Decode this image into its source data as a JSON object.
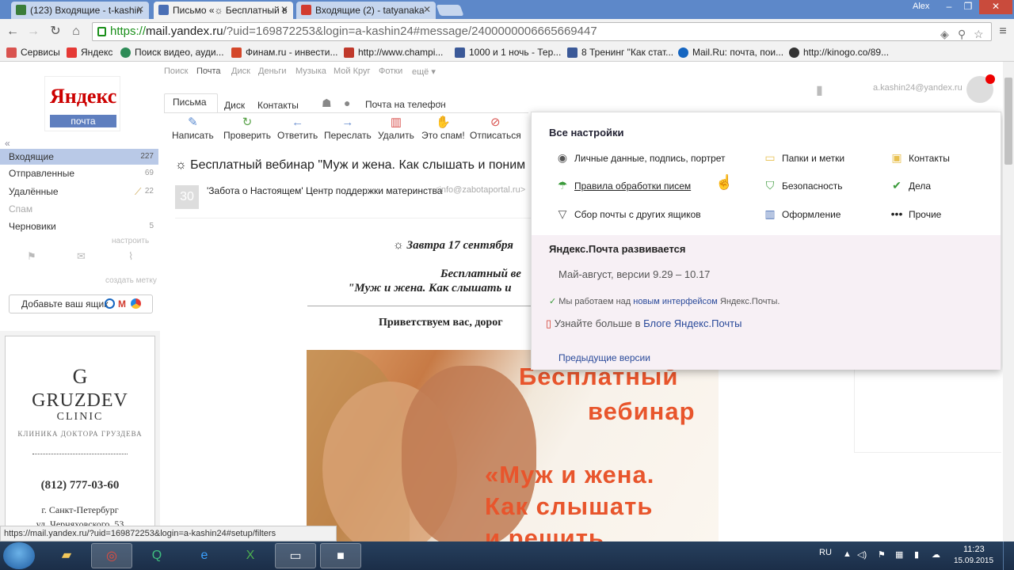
{
  "browser": {
    "tabs": [
      {
        "label": "(123) Входящие - t-kashin",
        "active": false,
        "favicon_color": "#3a7d3a"
      },
      {
        "label": "Письмо «☼ Бесплатный в",
        "active": true,
        "favicon_color": "#4a6fb5"
      },
      {
        "label": "Входящие (2) - tatyanaka",
        "active": false,
        "favicon_color": "#d23b2f"
      }
    ],
    "window_user": "Alex",
    "window_controls": {
      "minimize": "–",
      "maximize": "❐",
      "close": "✕"
    },
    "url": {
      "scheme": "https://",
      "host": "mail.yandex.ru",
      "rest": "/?uid=169872253&login=a-kashin24#message/2400000006665669447"
    },
    "bookmarks": [
      {
        "label": "Сервисы",
        "color": "#d9534f"
      },
      {
        "label": "Яндекс",
        "color": "#e53935"
      },
      {
        "label": "Поиск видео, ауди...",
        "color": "#2e8b57"
      },
      {
        "label": "Финам.ru - инвести...",
        "color": "#d4472a"
      },
      {
        "label": "http://www.champi...",
        "color": "#c0392b"
      },
      {
        "label": "1000 и 1 ночь - Тер...",
        "color": "#3b5998"
      },
      {
        "label": "8 Тренинг \"Как стат...",
        "color": "#3b5998"
      },
      {
        "label": "Mail.Ru: почта, пои...",
        "color": "#1565c0"
      },
      {
        "label": "http://kinogo.co/89...",
        "color": "#333333"
      }
    ],
    "status_url": "https://mail.yandex.ru/?uid=169872253&login=a-kashin24#setup/filters"
  },
  "topnav": [
    "Поиск",
    "Почта",
    "Диск",
    "Деньги",
    "Музыка",
    "Мой Круг",
    "Фотки",
    "ещё ▾"
  ],
  "logo": {
    "brand": "Яндекс",
    "product": "почта"
  },
  "collapse": "«",
  "folders": [
    {
      "label": "Входящие",
      "count": "227",
      "selected": true
    },
    {
      "label": "Отправленные",
      "count": "69",
      "selected": false
    },
    {
      "label": "Удалённые",
      "count": "22",
      "selected": false
    },
    {
      "label": "Спам",
      "count": "",
      "selected": false
    },
    {
      "label": "Черновики",
      "count": "5",
      "selected": false
    }
  ],
  "folder_setup": "настроить",
  "create_label": "создать метку",
  "add_mailbox": "Добавьте ваш ящик",
  "ad": {
    "logo_letter": "G",
    "name": "GRUZDEV",
    "sub": "CLINIC",
    "desc": "КЛИНИКА ДОКТОРА ГРУЗДЕВА",
    "phone": "(812) 777-03-60",
    "city": "г. Санкт-Петербург",
    "street": "ул. Черняховского, 53"
  },
  "mail_tabs": {
    "letters": "Письма",
    "disk": "Диск",
    "contacts": "Контакты",
    "phone": "Почта на телефон",
    "phone_close": "×"
  },
  "toolbar": [
    {
      "label": "Написать",
      "icon": "✎",
      "color": "#5b8bd0"
    },
    {
      "label": "Проверить",
      "icon": "↻",
      "color": "#5aa34a"
    },
    {
      "label": "Ответить",
      "icon": "←",
      "color": "#6b8fd0"
    },
    {
      "label": "Переслать",
      "icon": "→",
      "color": "#6b8fd0"
    },
    {
      "label": "Удалить",
      "icon": "🗑",
      "color": "#d9534f"
    },
    {
      "label": "Это спам!",
      "icon": "👍",
      "color": "#f0a500"
    },
    {
      "label": "Отписаться",
      "icon": "⊘",
      "color": "#d9534f"
    }
  ],
  "message": {
    "subject": "☼ Бесплатный вебинар \"Муж и жена. Как слышать и поним",
    "date": "30",
    "sender_name": "'Забота о Настоящем' Центр поддержки материнства",
    "sender_email": "<info@zabotaportal.ru>",
    "line1": "☼ Завтра 17 сентября",
    "line2": "Бесплатный ве",
    "line3": "\"Муж и жена. Как слышать и",
    "greeting": "Приветствуем вас, дорог",
    "overlay": [
      "Бесплатный",
      "вебинар",
      "«Муж и жена.",
      "Как слышать",
      "и решить"
    ]
  },
  "user_email": "a.kashin24@yandex.ru",
  "settings": {
    "title": "Все настройки",
    "items": [
      {
        "label": "Личные данные, подпись, портрет",
        "icon": "◉",
        "color": "#555"
      },
      {
        "label": "Папки и метки",
        "icon": "▭",
        "color": "#e8c050"
      },
      {
        "label": "Контакты",
        "icon": "▣",
        "color": "#e8c050"
      },
      {
        "label": "Правила обработки писем",
        "icon": "☂",
        "color": "#3a9a3a"
      },
      {
        "label": "Безопасность",
        "icon": "⛉",
        "color": "#3a9a3a"
      },
      {
        "label": "Дела",
        "icon": "✔",
        "color": "#3a9a3a"
      },
      {
        "label": "Сбор почты с других ящиков",
        "icon": "▽",
        "color": "#555"
      },
      {
        "label": "Оформление",
        "icon": "▥",
        "color": "#4a6fb5"
      },
      {
        "label": "Прочие",
        "icon": "•••",
        "color": "#222"
      }
    ],
    "dev_title": "Яндекс.Почта развивается",
    "dev_versions": "Май-август, версии 9.29 – 10.17",
    "dev_work_prefix": "Мы работаем над",
    "dev_work_link": "новым интерфейсом",
    "dev_work_suffix": "Яндекс.Почты.",
    "dev_blog_prefix": "Узнайте больше в",
    "dev_blog_link": "Блоге Яндекс.Почты",
    "dev_prev": "Предыдущие версии"
  },
  "taskbar": {
    "lang": "RU",
    "time": "11:23",
    "date": "15.09.2015"
  }
}
